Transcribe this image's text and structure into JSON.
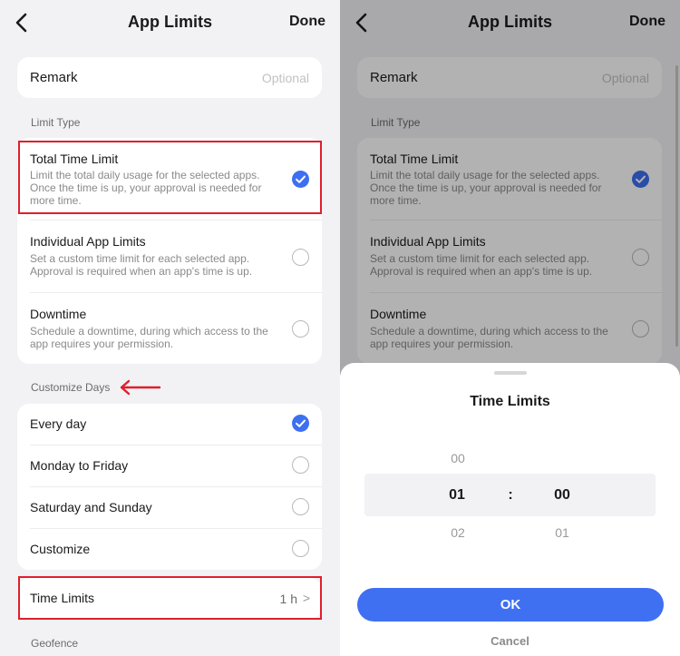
{
  "header": {
    "title": "App Limits",
    "done_label": "Done"
  },
  "remark": {
    "label": "Remark",
    "placeholder": "Optional"
  },
  "limit_type": {
    "section_label": "Limit Type",
    "options": [
      {
        "title": "Total Time Limit",
        "description": "Limit the total daily usage for the selected apps. Once the time is up, your approval is needed for more time.",
        "checked": true
      },
      {
        "title": "Individual App Limits",
        "description": "Set a custom time limit for each selected app. Approval is required when an app's time is up.",
        "checked": false
      },
      {
        "title": "Downtime",
        "description": "Schedule a downtime, during which access to the app requires your permission.",
        "checked": false
      }
    ]
  },
  "customize_days": {
    "section_label": "Customize Days",
    "options": [
      {
        "label": "Every day",
        "checked": true
      },
      {
        "label": "Monday to Friday",
        "checked": false
      },
      {
        "label": "Saturday and Sunday",
        "checked": false
      },
      {
        "label": "Customize",
        "checked": false
      }
    ]
  },
  "time_limits_row": {
    "label": "Time Limits",
    "value": "1 h",
    "chevron": ">"
  },
  "geofence": {
    "section_label": "Geofence"
  },
  "sheet": {
    "title": "Time Limits",
    "hours": {
      "prev": "00",
      "selected": "01",
      "next": "02"
    },
    "separator": ":",
    "minutes": {
      "selected": "00",
      "next": "01"
    },
    "ok_label": "OK",
    "cancel_label": "Cancel"
  },
  "colors": {
    "accent": "#3d6ff0",
    "highlight": "#e01f2b",
    "background": "#f2f2f5"
  }
}
